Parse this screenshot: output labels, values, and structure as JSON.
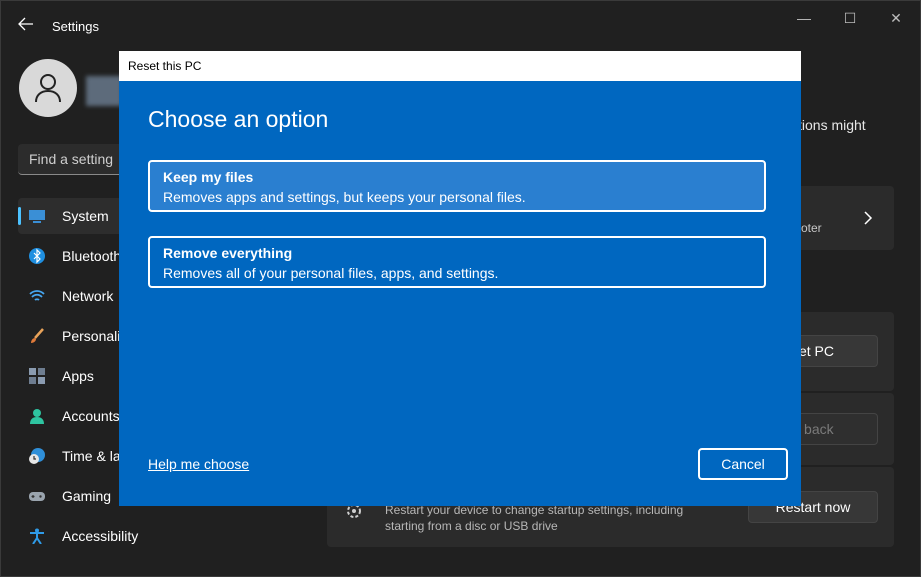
{
  "app": {
    "title": "Settings"
  },
  "window_controls": {
    "minimize": "—",
    "maximize": "☐",
    "close": "✕"
  },
  "search": {
    "placeholder": "Find a setting"
  },
  "sidebar": {
    "items": [
      {
        "label": "System",
        "icon": "monitor-icon",
        "selected": true
      },
      {
        "label": "Bluetooth",
        "icon": "bluetooth-icon"
      },
      {
        "label": "Network",
        "icon": "wifi-icon"
      },
      {
        "label": "Personaliz",
        "icon": "brush-icon"
      },
      {
        "label": "Apps",
        "icon": "apps-icon"
      },
      {
        "label": "Accounts",
        "icon": "person-icon"
      },
      {
        "label": "Time & la",
        "icon": "clock-globe-icon"
      },
      {
        "label": "Gaming",
        "icon": "gamepad-icon"
      },
      {
        "label": "Accessibility",
        "icon": "accessibility-icon"
      }
    ]
  },
  "background": {
    "partial_text": "tions might",
    "troubleshooter_fragment": "oter",
    "reset_pc_button": "set PC",
    "go_back_button": "o back",
    "startup_desc_line1": "Restart your device to change startup settings, including",
    "startup_desc_line2": "starting from a disc or USB drive",
    "restart_button": "Restart now"
  },
  "dialog": {
    "title": "Reset this PC",
    "heading": "Choose an option",
    "options": [
      {
        "title": "Keep my files",
        "desc": "Removes apps and settings, but keeps your personal files."
      },
      {
        "title": "Remove everything",
        "desc": "Removes all of your personal files, apps, and settings."
      }
    ],
    "help_link": "Help me choose",
    "cancel": "Cancel"
  },
  "colors": {
    "dialog_bg": "#0067c0",
    "accent": "#4cc2ff",
    "window_bg": "#202020"
  }
}
